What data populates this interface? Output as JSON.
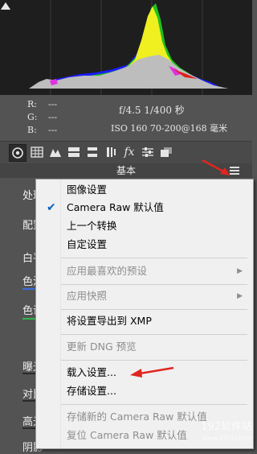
{
  "info": {
    "r_label": "R:",
    "g_label": "G:",
    "b_label": "B:",
    "r_value": "---",
    "g_value": "---",
    "b_value": "---",
    "camera_line1": "f/4.5   1/400 秒",
    "camera_line2": "ISO 160   70-200@168 毫米"
  },
  "toolbar": {
    "icons": [
      "aperture-icon",
      "grid-icon",
      "mountains-icon",
      "split-tone-icon",
      "detail-icon",
      "lens-icon",
      "fx-icon",
      "sliders-icon",
      "stack-icon"
    ],
    "active_index": 0
  },
  "section": {
    "title": "基本"
  },
  "left_panel": {
    "labels": [
      "处理",
      "配置",
      "白平",
      "色温",
      "色调",
      "曝光",
      "对比",
      "高光",
      "阴影"
    ]
  },
  "menu": {
    "items": [
      {
        "label": "图像设置",
        "checked": false,
        "disabled": false,
        "submenu": false
      },
      {
        "label": "Camera Raw 默认值",
        "checked": true,
        "disabled": false,
        "submenu": false
      },
      {
        "label": "上一个转换",
        "checked": false,
        "disabled": false,
        "submenu": false
      },
      {
        "label": "自定设置",
        "checked": false,
        "disabled": false,
        "submenu": false
      },
      {
        "label": "应用最喜欢的预设",
        "checked": false,
        "disabled": true,
        "submenu": true
      },
      {
        "label": "应用快照",
        "checked": false,
        "disabled": true,
        "submenu": true
      },
      {
        "label": "将设置导出到 XMP",
        "checked": false,
        "disabled": false,
        "submenu": false
      },
      {
        "label": "更新 DNG 预览",
        "checked": false,
        "disabled": true,
        "submenu": false
      },
      {
        "label": "载入设置...",
        "checked": false,
        "disabled": false,
        "submenu": false
      },
      {
        "label": "存储设置...",
        "checked": false,
        "disabled": false,
        "submenu": false
      },
      {
        "label": "存储新的 Camera Raw 默认值",
        "checked": false,
        "disabled": true,
        "submenu": false
      },
      {
        "label": "复位 Camera Raw 默认值",
        "checked": false,
        "disabled": true,
        "submenu": false
      }
    ]
  },
  "watermark": {
    "line1": "192软件站",
    "line2": "www.192ly.com"
  },
  "colors": {
    "accent_red": "#e0261f",
    "check_blue": "#0060c0",
    "panel_bg": "#535353",
    "menu_bg": "#f0f0f0"
  }
}
